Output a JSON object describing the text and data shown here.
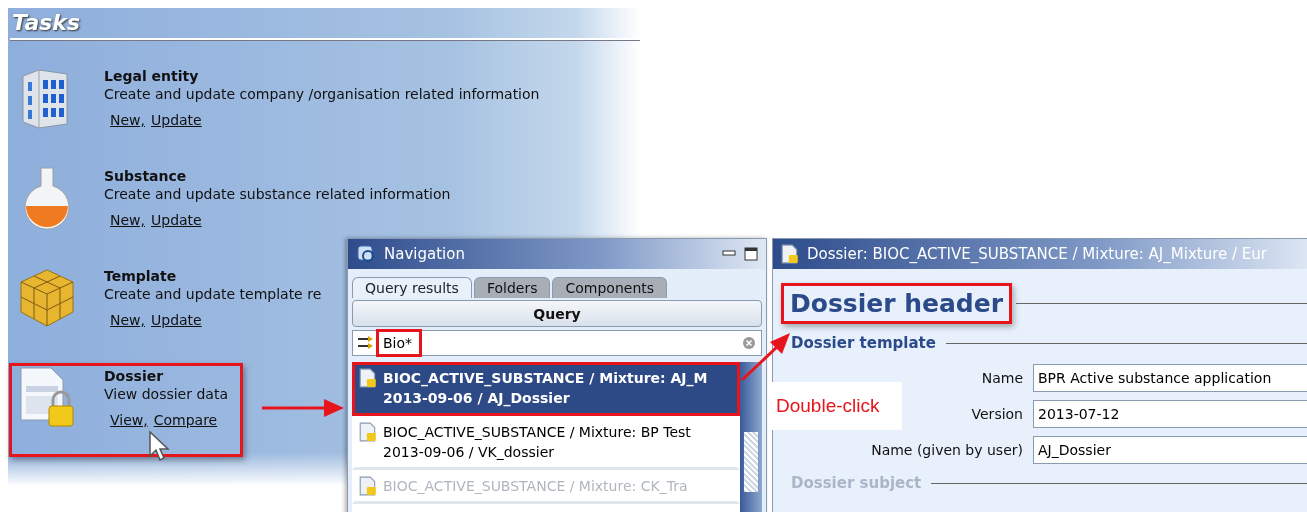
{
  "tasks": {
    "title": "Tasks",
    "items": [
      {
        "kind": "building",
        "name": "Legal entity",
        "description": "Create and update company /organisation related information",
        "links": [
          "New,",
          "Update"
        ],
        "highlighted": false
      },
      {
        "kind": "flask",
        "name": "Substance",
        "description": "Create and update substance related information",
        "links": [
          "New,",
          "Update"
        ],
        "highlighted": false
      },
      {
        "kind": "cube",
        "name": "Template",
        "description": "Create and update template re",
        "links": [
          "New,",
          "Update"
        ],
        "highlighted": false
      },
      {
        "kind": "dossier",
        "name": "Dossier",
        "description": "View dossier data",
        "links": [
          "View,",
          "Compare"
        ],
        "highlighted": true
      }
    ]
  },
  "navigation": {
    "title": "Navigation",
    "tabs": [
      {
        "label": "Query results",
        "selected": true
      },
      {
        "label": "Folders",
        "selected": false
      },
      {
        "label": "Components",
        "selected": false
      }
    ],
    "query_button": "Query",
    "search": {
      "value": "Bio*",
      "highlighted": true
    },
    "results": [
      {
        "line1": "BIOC_ACTIVE_SUBSTANCE / Mixture: AJ_M",
        "line2": "2013-09-06 / AJ_Dossier",
        "selected": true,
        "disabled": false,
        "highlighted": true
      },
      {
        "line1": "BIOC_ACTIVE_SUBSTANCE / Mixture: BP Test",
        "line2": "2013-09-06 / VK_dossier",
        "selected": false,
        "disabled": false,
        "highlighted": false
      },
      {
        "line1": "BIOC_ACTIVE_SUBSTANCE / Mixture: CK_Tra",
        "selected": false,
        "disabled": true,
        "highlighted": false
      }
    ]
  },
  "dossier": {
    "title": "Dossier: BIOC_ACTIVE_SUBSTANCE / Mixture: AJ_Mixture / Eur",
    "header": "Dossier header",
    "header_highlighted": true,
    "sections": [
      {
        "title": "Dossier template",
        "disabled": false,
        "fields": [
          {
            "label": "Name",
            "value": "BPR Active substance application"
          },
          {
            "label": "Version",
            "value": "2013-07-12"
          },
          {
            "label": "Name (given by user)",
            "value": "AJ_Dossier"
          }
        ]
      },
      {
        "title": "Dossier subject",
        "disabled": true
      }
    ]
  },
  "callout": "Double-click"
}
